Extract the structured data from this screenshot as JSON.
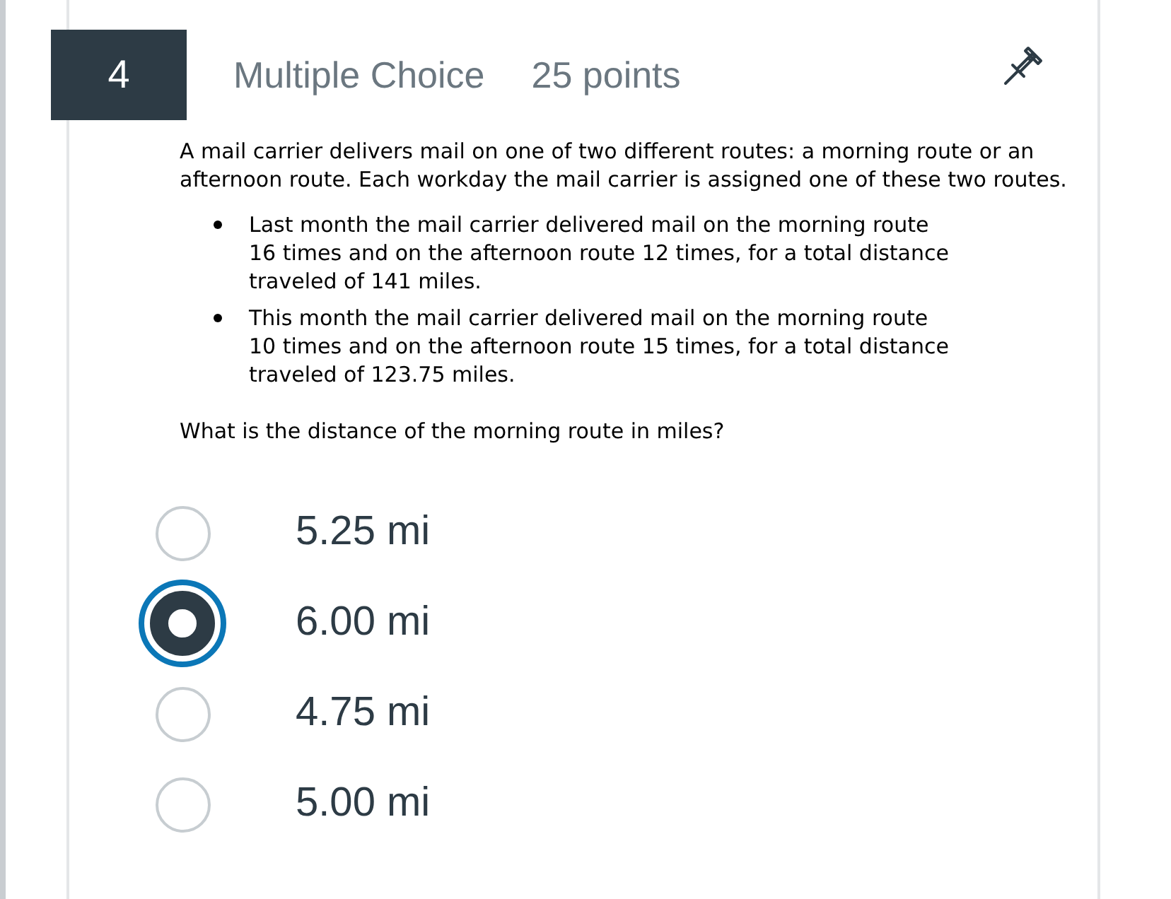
{
  "question": {
    "number": "4",
    "type": "Multiple Choice",
    "points": "25 points",
    "intro": "A mail carrier delivers mail on one of two different routes: a morning route or an afternoon route. Each workday the mail carrier is assigned one of these two routes.",
    "bullets": [
      "Last month the mail carrier delivered mail on the morning route 16 times and on the afternoon route 12 times, for a total distance traveled of 141 miles.",
      "This month the mail carrier delivered mail on the morning route 10 times and on the afternoon route 15 times, for a total distance traveled of 123.75 miles."
    ],
    "prompt": "What is the distance of the morning route in miles?",
    "answers": [
      {
        "label": "5.25 mi",
        "selected": false
      },
      {
        "label": "6.00 mi",
        "selected": true
      },
      {
        "label": "4.75 mi",
        "selected": false
      },
      {
        "label": "5.00 mi",
        "selected": false
      }
    ]
  }
}
